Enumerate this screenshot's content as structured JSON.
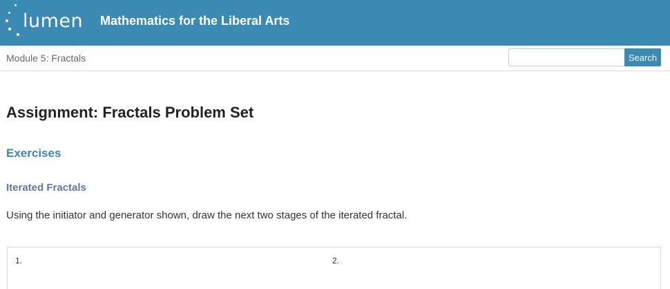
{
  "header": {
    "logo_text": "lumen",
    "course_title": "Mathematics for the Liberal Arts",
    "brand_color": "#3a8ab3"
  },
  "subbar": {
    "breadcrumb": "Module 5: Fractals",
    "search": {
      "placeholder": "",
      "value": "",
      "button_label": "Search"
    }
  },
  "main": {
    "page_title": "Assignment: Fractals Problem Set",
    "section_heading": "Exercises",
    "sub_heading": "Iterated Fractals",
    "instructions": "Using the initiator and generator shown, draw the next two stages of the iterated fractal.",
    "problems": [
      {
        "number": "1."
      },
      {
        "number": "2."
      }
    ]
  }
}
